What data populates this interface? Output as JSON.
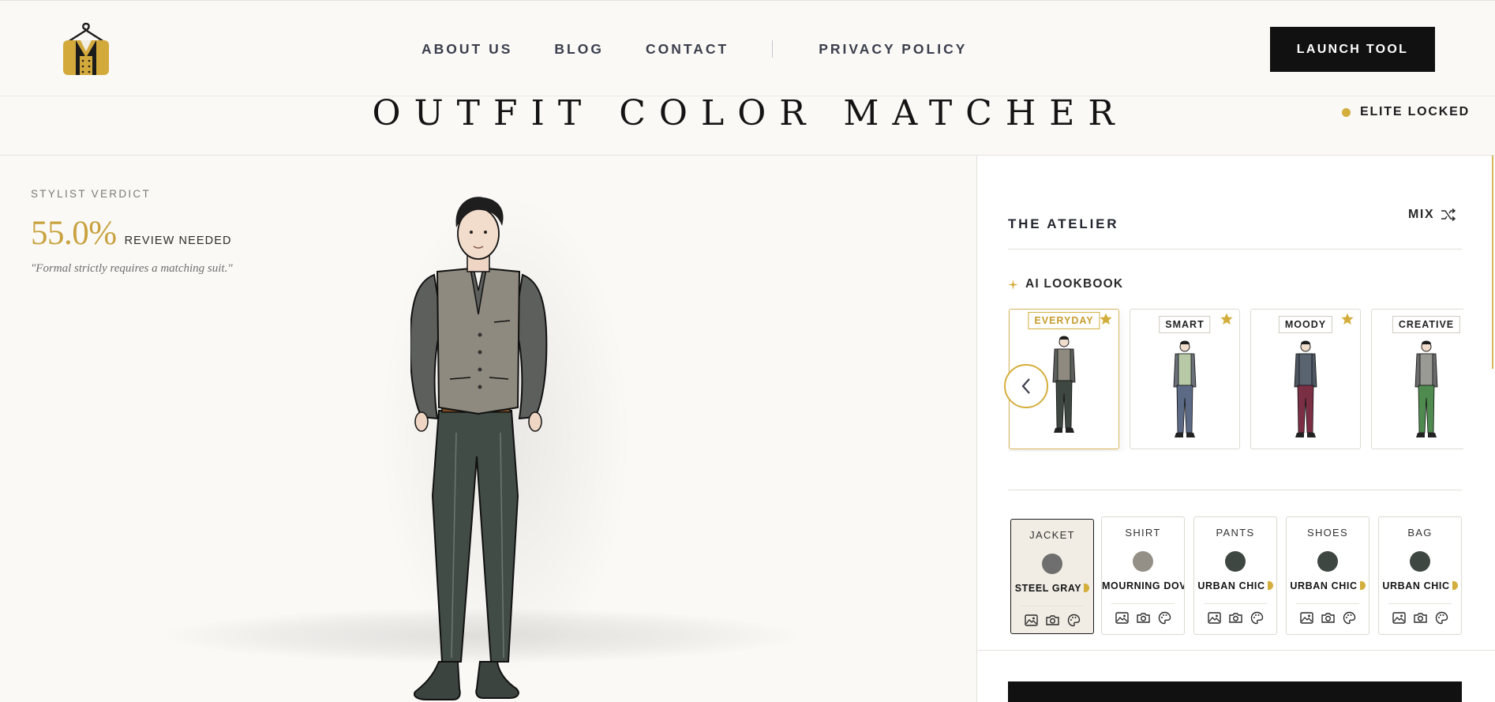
{
  "nav": {
    "links": [
      "ABOUT US",
      "BLOG",
      "CONTACT",
      "PRIVACY POLICY"
    ],
    "launch_label": "LAUNCH TOOL"
  },
  "page": {
    "title": "OUTFIT COLOR MATCHER",
    "elite_label": "ELITE LOCKED"
  },
  "verdict": {
    "label": "STYLIST VERDICT",
    "score": "55.0%",
    "status": "REVIEW NEEDED",
    "quote": "\"Formal strictly requires a matching suit.\""
  },
  "atelier": {
    "title": "THE ATELIER",
    "mix_label": "MIX"
  },
  "lookbook": {
    "title": "AI LOOKBOOK",
    "looks": [
      {
        "tag": "EVERYDAY",
        "starred": true,
        "active": true,
        "shirt": "#5d5f5c",
        "vest": "#8e8a7f",
        "pants": "#3e4742"
      },
      {
        "tag": "SMART",
        "starred": true,
        "active": false,
        "shirt": "#6b6f78",
        "vest": "#b7c9a7",
        "pants": "#5d6a86"
      },
      {
        "tag": "MOODY",
        "starred": true,
        "active": false,
        "shirt": "#4d5661",
        "vest": "#5a6370",
        "pants": "#7b2f45"
      },
      {
        "tag": "CREATIVE",
        "starred": false,
        "active": false,
        "shirt": "#6a6a6a",
        "vest": "#9a9a94",
        "pants": "#4f8a4f"
      }
    ]
  },
  "slots": [
    {
      "label": "JACKET",
      "name": "STEEL GRAY",
      "color": "#6f6f6f",
      "active": true
    },
    {
      "label": "SHIRT",
      "name": "MOURNING DOVE",
      "color": "#949088",
      "active": false
    },
    {
      "label": "PANTS",
      "name": "URBAN CHIC",
      "color": "#3f4743",
      "active": false
    },
    {
      "label": "SHOES",
      "name": "URBAN CHIC",
      "color": "#3f4743",
      "active": false
    },
    {
      "label": "BAG",
      "name": "URBAN CHIC",
      "color": "#3f4743",
      "active": false
    }
  ],
  "colors": {
    "accent_gold": "#d4ae3c",
    "ink": "#111111",
    "background": "#faf9f6"
  },
  "icons": {
    "logo": "hanger-suit-logo",
    "mix": "shuffle-icon",
    "lookbook": "sparkle-icon",
    "star": "star-icon",
    "carousel_prev": "chevron-left-icon",
    "slot_actions": [
      "image-icon",
      "camera-icon",
      "palette-icon"
    ]
  }
}
